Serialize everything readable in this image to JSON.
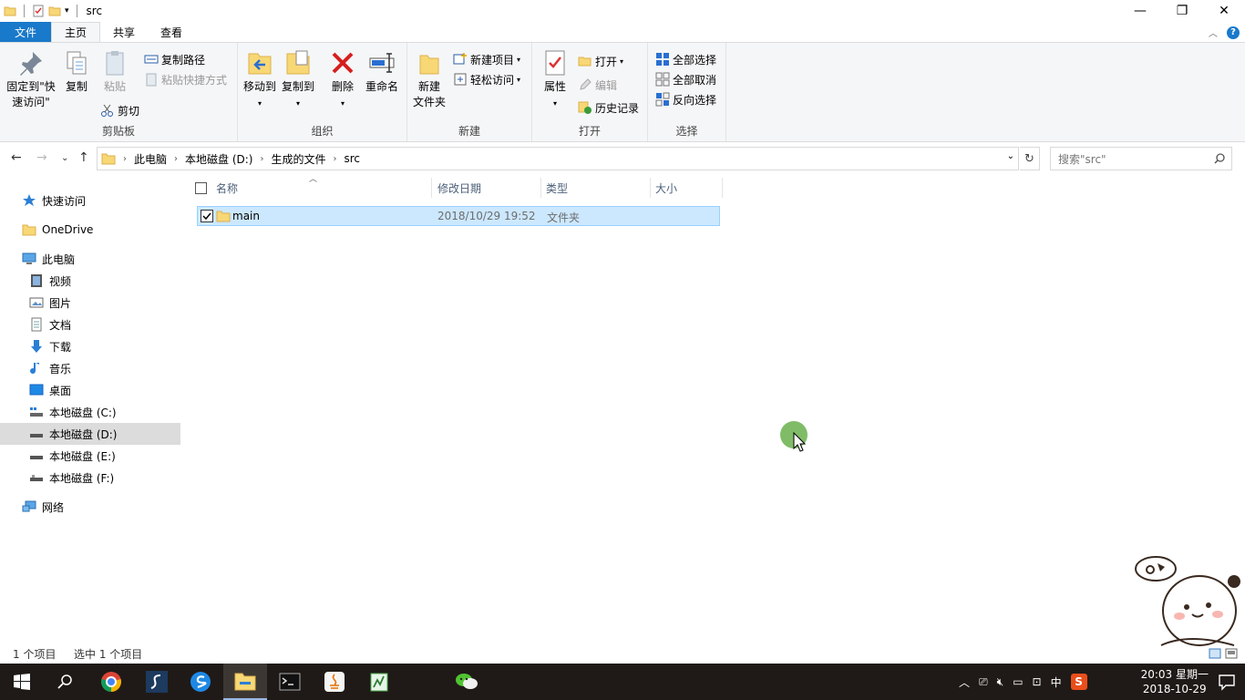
{
  "window": {
    "title": "src",
    "controls": [
      "minimize",
      "maximize",
      "close"
    ]
  },
  "ribbon_tabs": [
    {
      "label": "文件"
    },
    {
      "label": "主页"
    },
    {
      "label": "共享"
    },
    {
      "label": "查看"
    }
  ],
  "ribbon": {
    "clipboard": {
      "group_label": "剪贴板",
      "pin_label_1": "固定到\"快",
      "pin_label_2": "速访问\"",
      "copy": "复制",
      "paste": "粘贴",
      "copy_path": "复制路径",
      "paste_shortcut": "粘贴快捷方式",
      "cut": "剪切"
    },
    "organize": {
      "group_label": "组织",
      "move_to": "移动到",
      "copy_to": "复制到",
      "delete": "删除",
      "rename": "重命名"
    },
    "new": {
      "group_label": "新建",
      "new_folder_1": "新建",
      "new_folder_2": "文件夹",
      "new_item": "新建项目",
      "easy_access": "轻松访问"
    },
    "open": {
      "group_label": "打开",
      "properties": "属性",
      "open": "打开",
      "edit": "编辑",
      "history": "历史记录"
    },
    "select": {
      "group_label": "选择",
      "select_all": "全部选择",
      "select_none": "全部取消",
      "invert": "反向选择"
    }
  },
  "address": {
    "crumbs": [
      "此电脑",
      "本地磁盘 (D:)",
      "生成的文件",
      "src"
    ],
    "search_placeholder": "搜索\"src\""
  },
  "nav": [
    {
      "label": "快速访问",
      "icon": "star-icon"
    },
    {
      "label": "OneDrive",
      "icon": "folder-icon"
    },
    {
      "label": "此电脑",
      "icon": "computer-icon"
    },
    {
      "label": "视频",
      "icon": "video-icon"
    },
    {
      "label": "图片",
      "icon": "picture-icon"
    },
    {
      "label": "文档",
      "icon": "document-icon"
    },
    {
      "label": "下载",
      "icon": "download-icon"
    },
    {
      "label": "音乐",
      "icon": "music-icon"
    },
    {
      "label": "桌面",
      "icon": "desktop-icon"
    },
    {
      "label": "本地磁盘 (C:)",
      "icon": "drive-icon"
    },
    {
      "label": "本地磁盘 (D:)",
      "icon": "drive-icon"
    },
    {
      "label": "本地磁盘 (E:)",
      "icon": "drive-icon"
    },
    {
      "label": "本地磁盘 (F:)",
      "icon": "drive-icon"
    },
    {
      "label": "网络",
      "icon": "network-icon"
    }
  ],
  "columns": [
    "名称",
    "修改日期",
    "类型",
    "大小"
  ],
  "files": [
    {
      "name": "main",
      "modified": "2018/10/29 19:52",
      "type": "文件夹",
      "size": ""
    }
  ],
  "status": {
    "count": "1 个项目",
    "selected": "选中 1 个项目"
  },
  "taskbar": {
    "ime": "中",
    "time": "20:03 星期一",
    "date": "2018-10-29"
  },
  "colors": {
    "file_tab": "#1979ca",
    "selection": "#cce8ff",
    "taskbar": "#1f1a17"
  }
}
